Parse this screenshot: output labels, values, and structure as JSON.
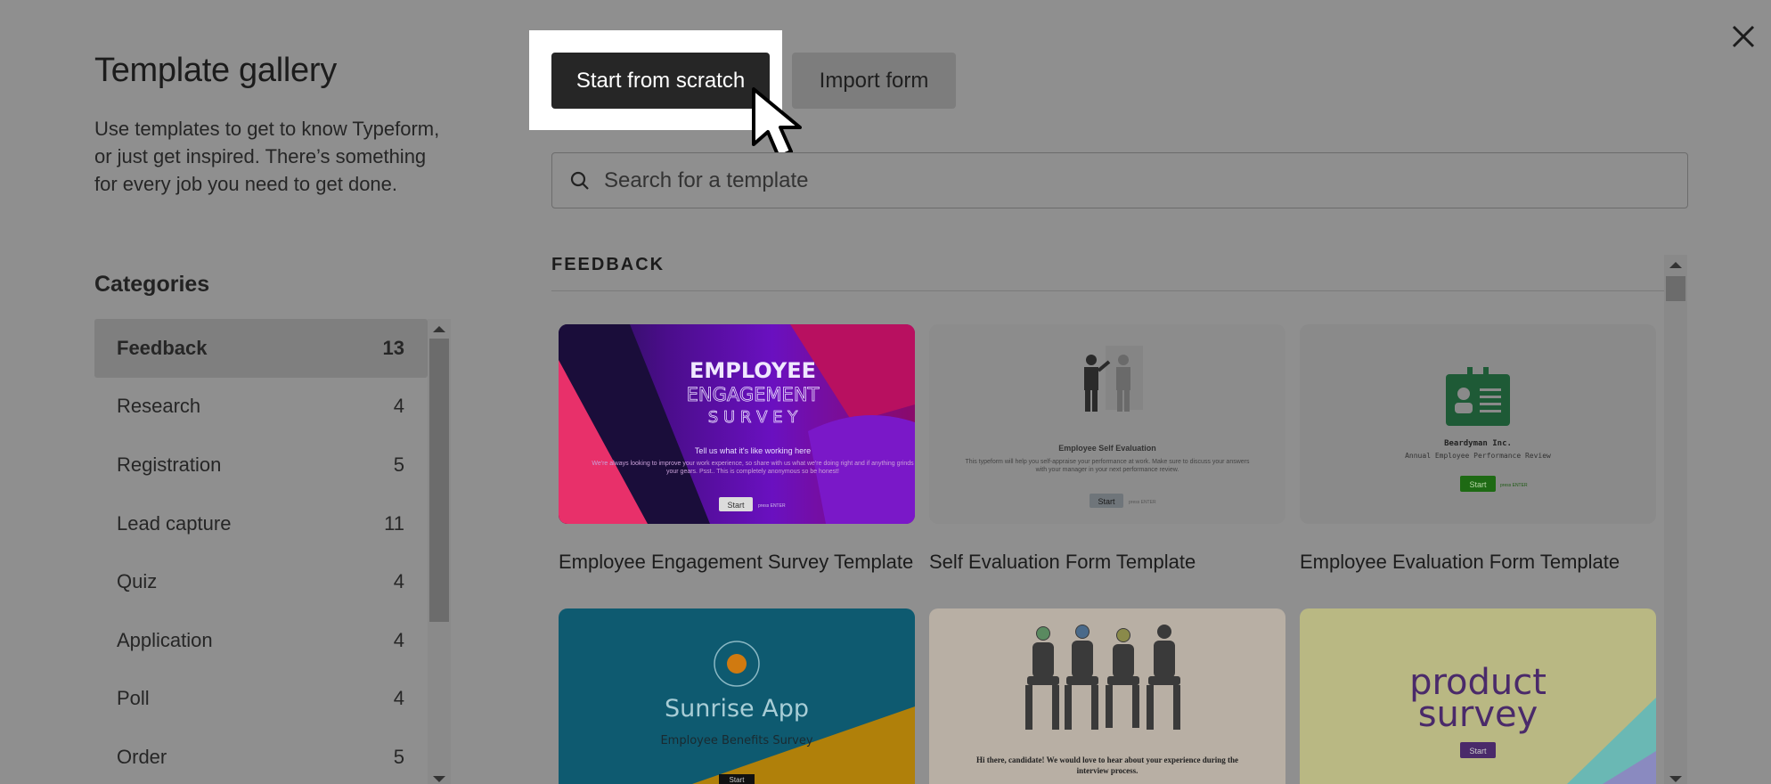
{
  "header": {
    "close_label": "×"
  },
  "sidebar": {
    "title": "Template gallery",
    "description": "Use templates to get to know Typeform, or just get inspired. There’s something for every job you need to get done.",
    "categories_title": "Categories",
    "categories": [
      {
        "label": "Feedback",
        "count": "13"
      },
      {
        "label": "Research",
        "count": "4"
      },
      {
        "label": "Registration",
        "count": "5"
      },
      {
        "label": "Lead capture",
        "count": "11"
      },
      {
        "label": "Quiz",
        "count": "4"
      },
      {
        "label": "Application",
        "count": "4"
      },
      {
        "label": "Poll",
        "count": "4"
      },
      {
        "label": "Order",
        "count": "5"
      }
    ]
  },
  "toolbar": {
    "scratch_label": "Start from scratch",
    "import_label": "Import form"
  },
  "search": {
    "placeholder": "Search for a template"
  },
  "section": {
    "title": "FEEDBACK"
  },
  "templates": [
    {
      "title": "Employee Engagement Survey Template",
      "thumb": {
        "line1": "EMPLOYEE",
        "line2": "ENGAGEMENT",
        "line3": "S U R V E Y",
        "tagline": "Tell us what it's like working here",
        "body": "We're always looking to improve your work experience, so share with us what we're doing right and if anything grinds your gears. Psst.. This is completely anonymous so be honest!",
        "button": "Start",
        "hint": "press ENTER"
      }
    },
    {
      "title": "Self Evaluation Form Template",
      "thumb": {
        "heading": "Employee Self Evaluation",
        "body": "This typeform will help you self-appraise your performance at work. Make sure to discuss your answers with your manager in your next performance review.",
        "button": "Start",
        "hint": "press ENTER"
      }
    },
    {
      "title": "Employee Evaluation Form Template",
      "thumb": {
        "heading": "Beardyman Inc.",
        "sub": "Annual Employee Performance Review",
        "button": "Start",
        "hint": "press ENTER"
      }
    },
    {
      "title": "",
      "thumb": {
        "heading": "Sunrise App",
        "sub": "Employee Benefits Survey",
        "button": "Start"
      }
    },
    {
      "title": "",
      "thumb": {
        "body": "Hi there, candidate! We would love to hear about your experience during the interview process."
      }
    },
    {
      "title": "",
      "thumb": {
        "line1": "product",
        "line2": "survey",
        "button": "Start"
      }
    }
  ],
  "colors": {
    "overlay": "#8f8f8f",
    "primary_button": "#262626",
    "highlight": "#ffffff"
  }
}
